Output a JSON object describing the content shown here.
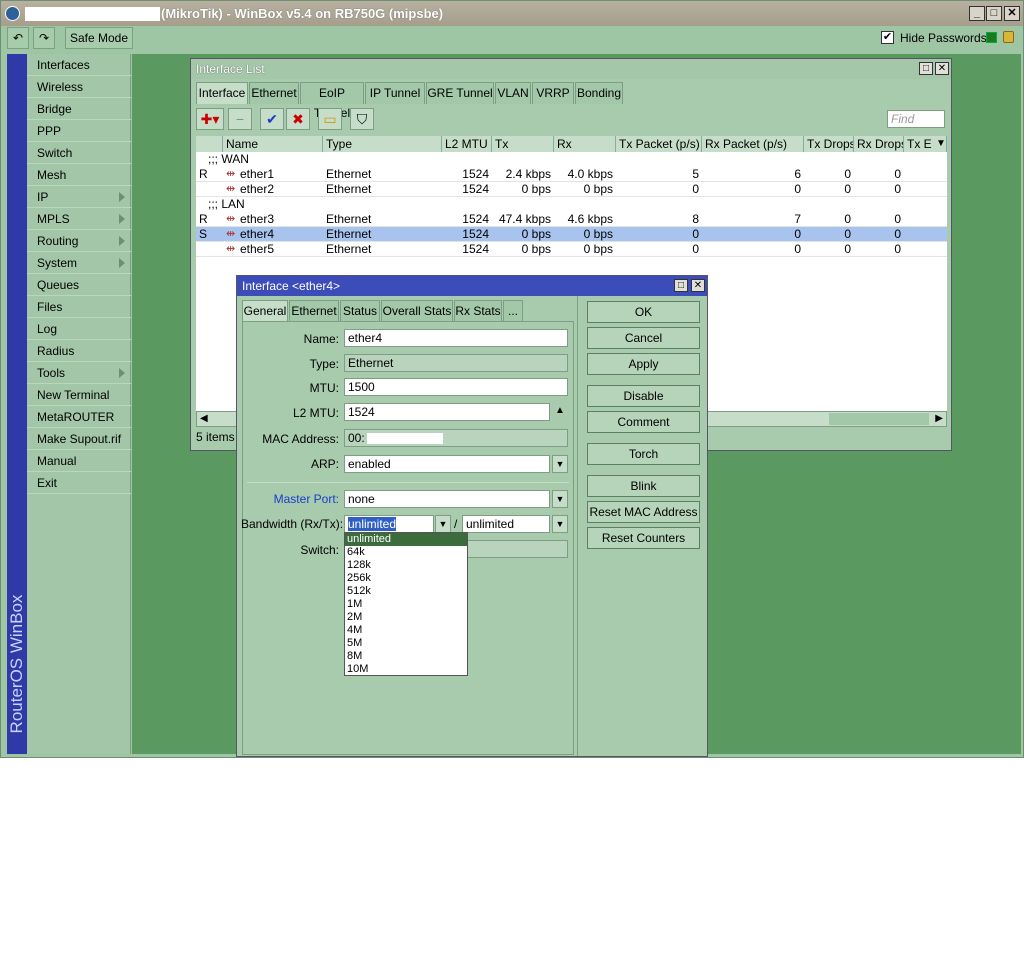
{
  "titlebar": {
    "title": "(MikroTik) - WinBox v5.4 on RB750G (mipsbe)",
    "min": "_",
    "max": "□",
    "close": "✕"
  },
  "toolbar": {
    "undo": "↶",
    "redo": "↷",
    "safe_mode": "Safe Mode",
    "hide_passwords": "Hide Passwords"
  },
  "brand": "RouterOS WinBox",
  "menu": [
    {
      "label": "Interfaces",
      "sub": false
    },
    {
      "label": "Wireless",
      "sub": false
    },
    {
      "label": "Bridge",
      "sub": false
    },
    {
      "label": "PPP",
      "sub": false
    },
    {
      "label": "Switch",
      "sub": false
    },
    {
      "label": "Mesh",
      "sub": false
    },
    {
      "label": "IP",
      "sub": true
    },
    {
      "label": "MPLS",
      "sub": true
    },
    {
      "label": "Routing",
      "sub": true
    },
    {
      "label": "System",
      "sub": true
    },
    {
      "label": "Queues",
      "sub": false
    },
    {
      "label": "Files",
      "sub": false
    },
    {
      "label": "Log",
      "sub": false
    },
    {
      "label": "Radius",
      "sub": false
    },
    {
      "label": "Tools",
      "sub": true
    },
    {
      "label": "New Terminal",
      "sub": false
    },
    {
      "label": "MetaROUTER",
      "sub": false
    },
    {
      "label": "Make Supout.rif",
      "sub": false
    },
    {
      "label": "Manual",
      "sub": false
    },
    {
      "label": "Exit",
      "sub": false
    }
  ],
  "iflist": {
    "title": "Interface List",
    "tabs": [
      "Interface",
      "Ethernet",
      "EoIP Tunnel",
      "IP Tunnel",
      "GRE Tunnel",
      "VLAN",
      "VRRP",
      "Bonding"
    ],
    "find_placeholder": "Find",
    "columns": [
      "Name",
      "Type",
      "L2 MTU",
      "Tx",
      "Rx",
      "Tx Packet (p/s)",
      "Rx Packet (p/s)",
      "Tx Drops",
      "Rx Drops",
      "Tx E"
    ],
    "group_wan": ";;; WAN",
    "group_lan": ";;; LAN",
    "rows": [
      {
        "flag": "R",
        "name": "ether1",
        "type": "Ethernet",
        "l2mtu": "1524",
        "tx": "2.4 kbps",
        "rx": "4.0 kbps",
        "txp": "5",
        "rxp": "6",
        "txd": "0",
        "rxd": "0"
      },
      {
        "flag": "",
        "name": "ether2",
        "type": "Ethernet",
        "l2mtu": "1524",
        "tx": "0 bps",
        "rx": "0 bps",
        "txp": "0",
        "rxp": "0",
        "txd": "0",
        "rxd": "0"
      },
      {
        "flag": "R",
        "name": "ether3",
        "type": "Ethernet",
        "l2mtu": "1524",
        "tx": "47.4 kbps",
        "rx": "4.6 kbps",
        "txp": "8",
        "rxp": "7",
        "txd": "0",
        "rxd": "0"
      },
      {
        "flag": "S",
        "name": "ether4",
        "type": "Ethernet",
        "l2mtu": "1524",
        "tx": "0 bps",
        "rx": "0 bps",
        "txp": "0",
        "rxp": "0",
        "txd": "0",
        "rxd": "0"
      },
      {
        "flag": "",
        "name": "ether5",
        "type": "Ethernet",
        "l2mtu": "1524",
        "tx": "0 bps",
        "rx": "0 bps",
        "txp": "0",
        "rxp": "0",
        "txd": "0",
        "rxd": "0"
      }
    ],
    "status": "5 items ("
  },
  "dialog": {
    "title": "Interface <ether4>",
    "tabs": [
      "General",
      "Ethernet",
      "Status",
      "Overall Stats",
      "Rx Stats",
      "..."
    ],
    "name_label": "Name:",
    "name": "ether4",
    "type_label": "Type:",
    "type": "Ethernet",
    "mtu_label": "MTU:",
    "mtu": "1500",
    "l2mtu_label": "L2 MTU:",
    "l2mtu": "1524",
    "mac_label": "MAC Address:",
    "mac": "00:",
    "arp_label": "ARP:",
    "arp": "enabled",
    "master_label": "Master Port:",
    "master": "none",
    "bw_label": "Bandwidth (Rx/Tx):",
    "bw_rx": "unlimited",
    "bw_sep": "/",
    "bw_tx": "unlimited",
    "switch_label": "Switch:",
    "buttons": [
      "OK",
      "Cancel",
      "Apply",
      "Disable",
      "Comment",
      "Torch",
      "Blink",
      "Reset MAC Address",
      "Reset Counters"
    ],
    "options": [
      "unlimited",
      "64k",
      "128k",
      "256k",
      "512k",
      "1M",
      "2M",
      "4M",
      "5M",
      "8M",
      "10M"
    ]
  }
}
